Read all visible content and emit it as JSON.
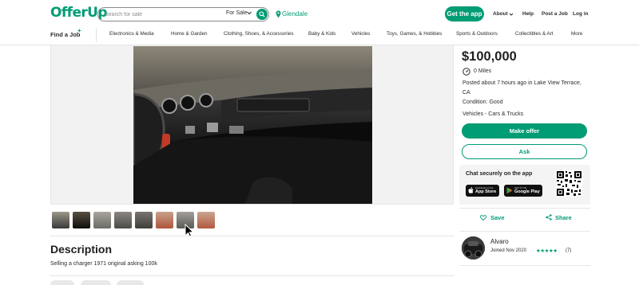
{
  "header": {
    "logo": "OfferUp",
    "search_placeholder": "Search for sale",
    "category": "For Sale",
    "location": "Glendale",
    "get_app": "Get the app",
    "links": {
      "about": "About",
      "help": "Help",
      "post_job": "Post a Job",
      "login": "Log in"
    }
  },
  "nav": {
    "find_job": "Find a Job",
    "find_job_badge": "+",
    "items": [
      "Electronics & Media",
      "Home & Garden",
      "Clothing, Shoes, & Accessories",
      "Baby & Kids",
      "Vehicles",
      "Toys, Games, & Hobbies",
      "Sports & Outdoors",
      "Collectibles & Art",
      "More"
    ]
  },
  "listing": {
    "price": "$100,000",
    "miles": "0 Miles",
    "posted": "Posted about 7 hours ago in Lake View Terrace, CA",
    "condition": "Condition: Good",
    "category_path": "Vehicles - Cars & Trucks",
    "make_offer": "Make offer",
    "ask": "Ask",
    "description_title": "Description",
    "description": "Selling a charger 1971 original asking 100k"
  },
  "chat_card": {
    "title": "Chat securely on the app",
    "app_store_small": "Download on the",
    "app_store": "App Store",
    "google_play_small": "GET IT ON",
    "google_play": "Google Play"
  },
  "actions": {
    "save": "Save",
    "share": "Share"
  },
  "seller": {
    "name": "Alvaro",
    "joined": "Joined Nov 2020",
    "stars": "★★★★★",
    "rating_count": "(7)"
  },
  "colors": {
    "brand": "#009c74",
    "text": "#2c2c2c"
  },
  "thumbnails": [
    "interior-1",
    "interior-2",
    "interior-3",
    "interior-4",
    "interior-5",
    "exterior-red-1",
    "interior-6",
    "exterior-red-2"
  ]
}
